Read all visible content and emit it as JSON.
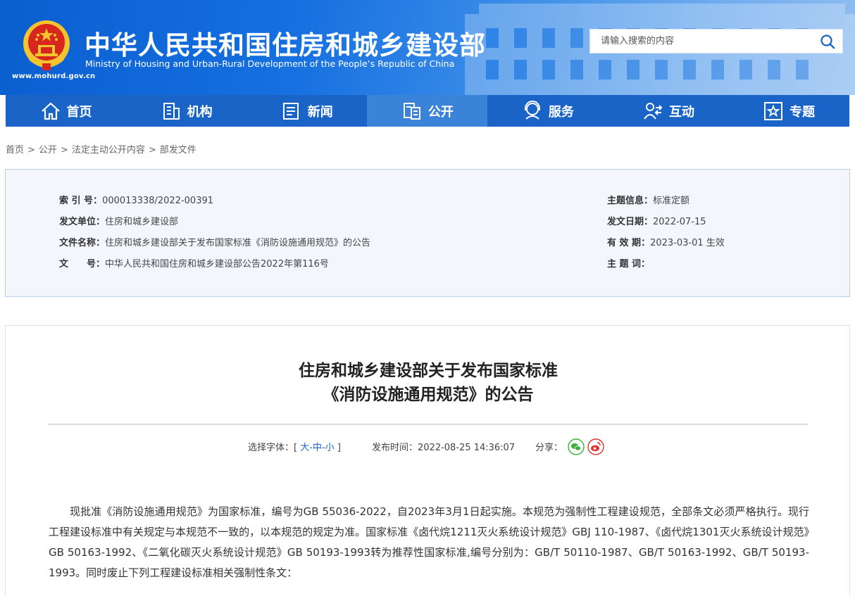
{
  "header": {
    "site_url": "www.mohurd.gov.cn",
    "title_cn": "中华人民共和国住房和城乡建设部",
    "title_en": "Ministry of Housing and Urban-Rural Development of the People’s Republic of China",
    "search_placeholder": "请输入搜索的内容",
    "search_icon": "search-icon",
    "brand_color": "#1a64c8"
  },
  "nav": {
    "items": [
      {
        "label": "首页",
        "icon": "home-icon"
      },
      {
        "label": "机构",
        "icon": "building-icon"
      },
      {
        "label": "新闻",
        "icon": "newspaper-icon"
      },
      {
        "label": "公开",
        "icon": "document-icon",
        "active": true
      },
      {
        "label": "服务",
        "icon": "service-icon"
      },
      {
        "label": "互动",
        "icon": "interaction-icon"
      },
      {
        "label": "专题",
        "icon": "star-icon"
      }
    ]
  },
  "breadcrumb": {
    "items": [
      "首页",
      "公开",
      "法定主动公开内容",
      "部发文件"
    ],
    "separator": ">"
  },
  "info": {
    "index_key": "索 引 号：",
    "index_value": "000013338/2022-00391",
    "issuer_key": "发文单位：",
    "issuer_value": "住房和城乡建设部",
    "docname_key": "文件名称：",
    "docname_value": "住房和城乡建设部关于发布国家标准《消防设施通用规范》的公告",
    "docno_key": "文　　号：",
    "docno_value": "中华人民共和国住房和城乡建设部公告2022年第116号",
    "topic_key": "主题信息：",
    "topic_value": "标准定额",
    "date_key": "发文日期：",
    "date_value": "2022-07-15",
    "valid_key": "有 效 期：",
    "valid_value": "2023-03-01 生效",
    "keywords_key": "主 题 词：",
    "keywords_value": ""
  },
  "article": {
    "title_line1": "住房和城乡建设部关于发布国家标准",
    "title_line2": "《消防设施通用规范》的公告",
    "font_label": "选择字体：[",
    "font_large": "大",
    "font_medium": "中",
    "font_small": "小",
    "font_close": "]",
    "font_sep": "-",
    "publish_label": "发布时间：",
    "publish_time": "2022-08-25 14:36:07",
    "share_label": "分享：",
    "share_icons": [
      "wechat-icon",
      "weibo-icon"
    ],
    "paragraph": "现批准《消防设施通用规范》为国家标准，编号为GB 55036-2022，自2023年3月1日起实施。本规范为强制性工程建设规范，全部条文必须严格执行。现行工程建设标准中有关规定与本规范不一致的，以本规范的规定为准。国家标准《卤代烷1211灭火系统设计规范》GBJ 110-1987、《卤代烷1301灭火系统设计规范》GB 50163-1992、《二氧化碳灭火系统设计规范》GB 50193-1993转为推荐性国家标准,编号分别为：GB/T 50110-1987、GB/T 50163-1992、GB/T 50193-1993。同时废止下列工程建设标准相关强制性条文："
  }
}
